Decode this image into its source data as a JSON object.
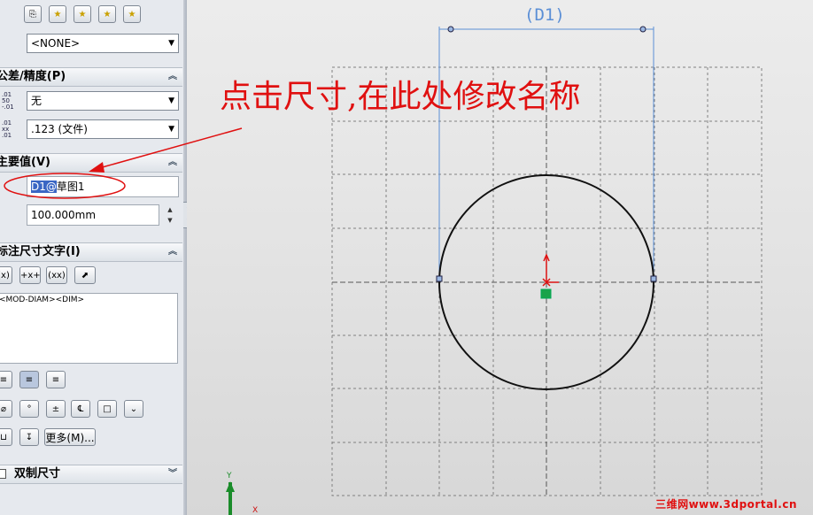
{
  "toolbar": {
    "buttons": [
      "favorites-manage-icon",
      "add-favorite-icon",
      "delete-favorite-icon",
      "save-favorite-icon",
      "load-favorite-icon"
    ],
    "favorite_select": "<NONE>"
  },
  "tolerance": {
    "title": "公差/精度(P)",
    "tolerance_type": "无",
    "precision": ".123 (文件)"
  },
  "primary_value": {
    "title": "主要值(V)",
    "name_value": "D1@草图1",
    "name_selected_part": "D1@",
    "name_rest": "草图1",
    "dimension_value": "100.000mm"
  },
  "dim_text": {
    "title": "标注尺寸文字(I)",
    "format_buttons": [
      "(x)",
      "+x+",
      "(xx)"
    ],
    "text_content": "<MOD-DIAM><DIM>",
    "more_label": "更多(M)..."
  },
  "dual": {
    "title": "双制尺寸"
  },
  "sketch": {
    "dimension_label": "(D1)",
    "axis_y": "Y",
    "axis_x": "X"
  },
  "annotation": {
    "text": "点击尺寸,在此处修改名称"
  },
  "watermark": {
    "text": "三维网www.3dportal.cn"
  },
  "colors": {
    "annotation": "#e01010",
    "dimension": "#5b8fd6",
    "selection": "#3a66c4"
  }
}
